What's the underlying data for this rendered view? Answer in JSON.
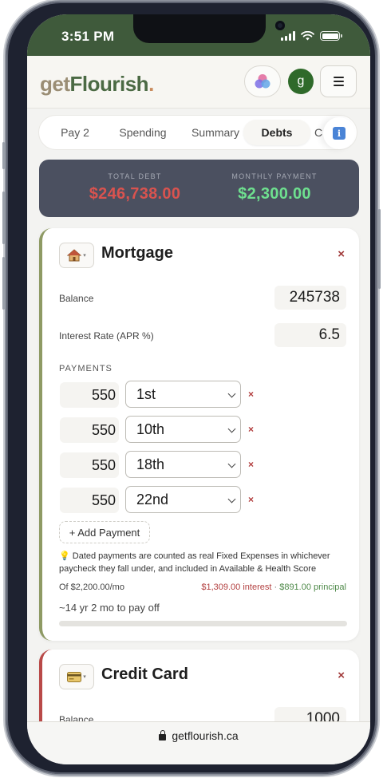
{
  "status_bar": {
    "time": "3:51 PM"
  },
  "header": {
    "logo_part1": "get",
    "logo_part2": "Flourish",
    "logo_dot": ".",
    "avatar_initial": "g"
  },
  "tabs": [
    {
      "label": "Pay 2",
      "active": false
    },
    {
      "label": "Spending",
      "active": false
    },
    {
      "label": "Summary",
      "active": false
    },
    {
      "label": "Debts",
      "active": true
    },
    {
      "label": "C",
      "active": false
    }
  ],
  "totals": {
    "total_debt_label": "TOTAL DEBT",
    "total_debt_value": "$246,738.00",
    "monthly_payment_label": "MONTHLY PAYMENT",
    "monthly_payment_value": "$2,300.00"
  },
  "mortgage": {
    "icon": "house-icon",
    "title": "Mortgage",
    "balance_label": "Balance",
    "balance_value": "245738",
    "rate_label": "Interest Rate (APR %)",
    "rate_value": "6.5",
    "payments_label": "PAYMENTS",
    "payments": [
      {
        "amount": "550",
        "day": "1st"
      },
      {
        "amount": "550",
        "day": "10th"
      },
      {
        "amount": "550",
        "day": "18th"
      },
      {
        "amount": "550",
        "day": "22nd"
      }
    ],
    "add_payment_label": "+ Add Payment",
    "note": "💡 Dated payments are counted as real Fixed Expenses in whichever paycheck they fall under, and included in Available & Health Score",
    "of_per_month": "Of $2,200.00/mo",
    "interest_text": "$1,309.00 interest",
    "separator": " · ",
    "principal_text": "$891.00 principal",
    "payoff_text": "~14 yr 2 mo to pay off",
    "payoff_progress": 0.0
  },
  "credit_card": {
    "icon": "credit-card-icon",
    "title": "Credit Card",
    "balance_label": "Balance",
    "balance_value": "1000"
  },
  "safari": {
    "url": "getflourish.ca"
  },
  "colors": {
    "total_debt_red": "#d9534f",
    "monthly_green": "#6ee08f",
    "interest_red": "#b34040",
    "principal_green": "#4f8a4a",
    "brand_green": "#3f5a3b"
  }
}
